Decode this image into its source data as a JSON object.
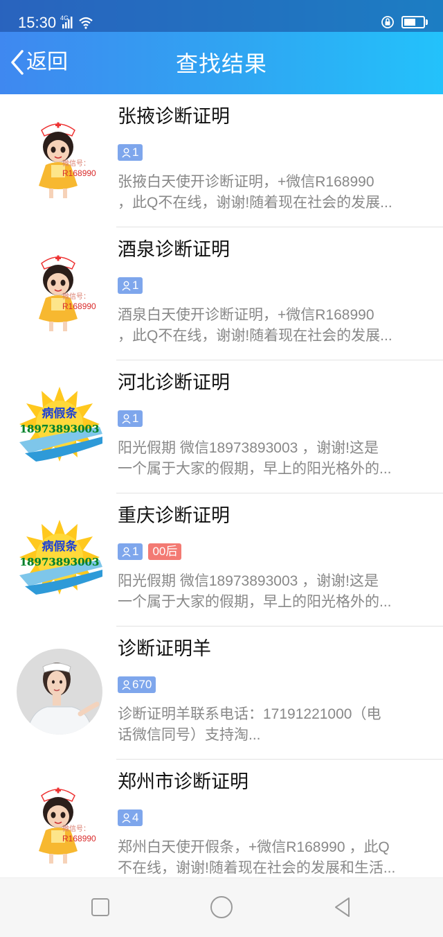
{
  "status_bar": {
    "time": "15:30",
    "network_label": "4G"
  },
  "nav": {
    "back_label": "返回",
    "title": "查找结果"
  },
  "results": [
    {
      "name": "张掖诊断证明",
      "members": "1",
      "tag": "",
      "avatar_icon": "nurse-cartoon-icon",
      "avatar_text_1": "微信号：",
      "avatar_text_2": "R168990",
      "desc_line_1": "张掖白天使开诊断证明，+微信R168990",
      "desc_line_2": "，此Q不在线，谢谢!随着现在社会的发展..."
    },
    {
      "name": "酒泉诊断证明",
      "members": "1",
      "tag": "",
      "avatar_icon": "nurse-cartoon-icon",
      "avatar_text_1": "微信号：",
      "avatar_text_2": "R168990",
      "desc_line_1": "酒泉白天使开诊断证明，+微信R168990",
      "desc_line_2": "，此Q不在线，谢谢!随着现在社会的发展..."
    },
    {
      "name": "河北诊断证明",
      "members": "1",
      "tag": "",
      "avatar_icon": "sun-logo-icon",
      "avatar_text_1": "病假条",
      "avatar_text_2": "18973893003",
      "desc_line_1": "阳光假期 微信18973893003 ，谢谢!这是",
      "desc_line_2": "一个属于大家的假期，早上的阳光格外的..."
    },
    {
      "name": "重庆诊断证明",
      "members": "1",
      "tag": "00后",
      "avatar_icon": "sun-logo-icon",
      "avatar_text_1": "病假条",
      "avatar_text_2": "18973893003",
      "desc_line_1": "阳光假期 微信18973893003 ，谢谢!这是",
      "desc_line_2": "一个属于大家的假期，早上的阳光格外的..."
    },
    {
      "name": "诊断证明羊",
      "members": "670",
      "tag": "",
      "avatar_icon": "nurse-photo-icon",
      "avatar_text_1": "",
      "avatar_text_2": "",
      "desc_line_1": "诊断证明羊联系电话：17191221000（电",
      "desc_line_2": "话微信同号）支持淘..."
    },
    {
      "name": "郑州市诊断证明",
      "members": "4",
      "tag": "",
      "avatar_icon": "nurse-cartoon-icon",
      "avatar_text_1": "微信号：",
      "avatar_text_2": "R168990",
      "desc_line_1": "郑州白天使开假条，+微信R168990 ，此Q",
      "desc_line_2": "不在线，谢谢!随着现在社会的发展和生活..."
    }
  ],
  "colors": {
    "header_start": "#3f88f0",
    "header_end": "#23c2fb",
    "member_tag": "#7ea6ec",
    "age_tag": "#f37a73"
  },
  "bottom_nav": {
    "icons": [
      "square-icon",
      "circle-icon",
      "triangle-back-icon"
    ]
  }
}
